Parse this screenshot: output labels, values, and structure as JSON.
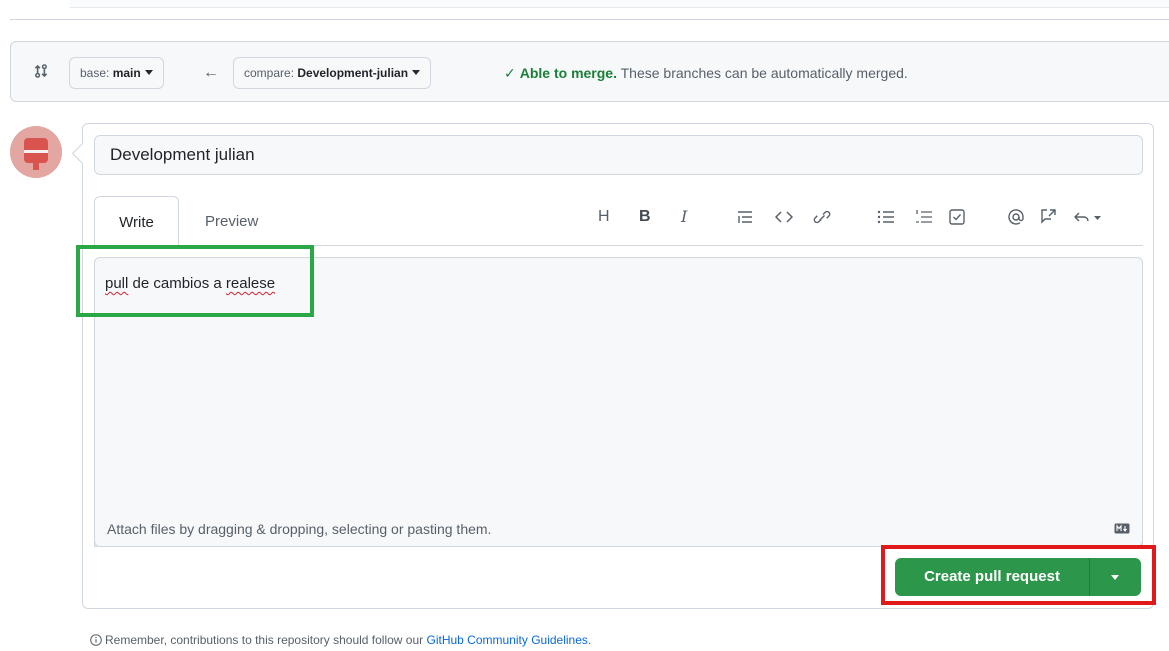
{
  "compare": {
    "base_prefix": "base: ",
    "base_branch": "main",
    "compare_prefix": "compare: ",
    "compare_branch": "Development-julian",
    "merge_ok": "Able to merge.",
    "merge_msg": "These branches can be automatically merged."
  },
  "form": {
    "title": "Development julian",
    "tab_write": "Write",
    "tab_preview": "Preview",
    "body_word1": "pull",
    "body_mid": " de cambios a ",
    "body_word2": "realese",
    "attach_text": "Attach files by dragging & dropping, selecting or pasting them."
  },
  "toolbar": {
    "heading": "H",
    "bold": "B",
    "italic": "I"
  },
  "actions": {
    "create_label": "Create pull request"
  },
  "footer": {
    "remember_text": "Remember, contributions to this repository should follow our ",
    "link_text": "GitHub Community Guidelines",
    "period": "."
  },
  "colors": {
    "merge_green": "#1a7f37",
    "button_green": "#2c974b",
    "highlight_green": "#2aa845",
    "highlight_red": "#e0191b",
    "link_blue": "#0969da"
  }
}
